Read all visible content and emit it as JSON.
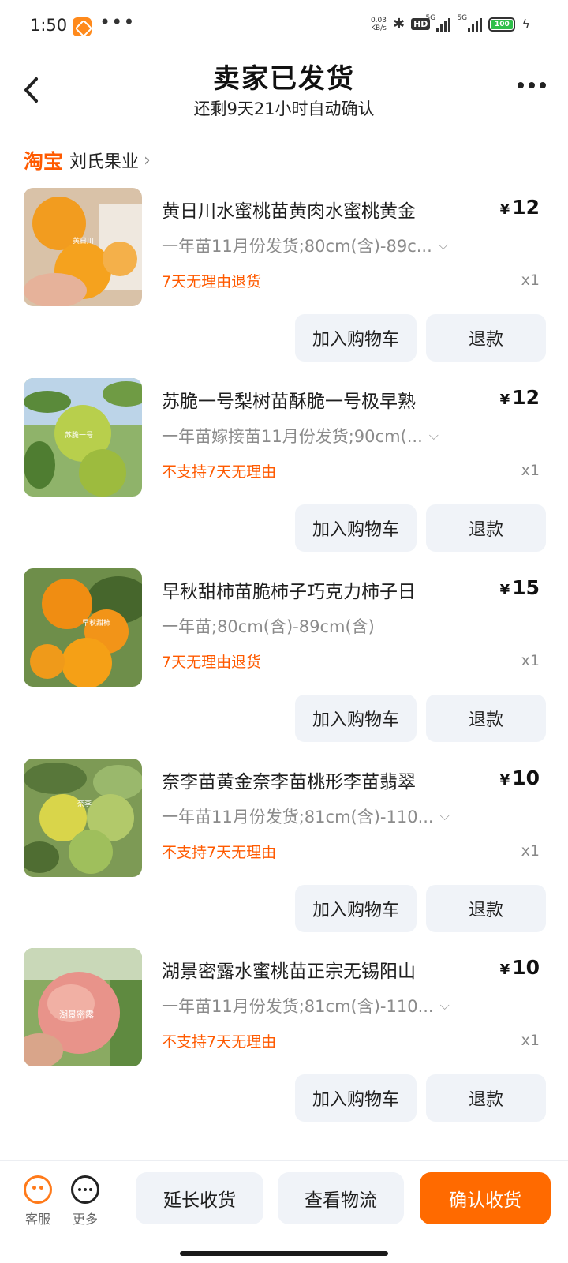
{
  "status_bar": {
    "time": "1:50",
    "net_speed_value": "0.03",
    "net_speed_unit": "KB/s",
    "hd_badge": "HD",
    "signal1_label": "5G",
    "signal2_label": "5G",
    "battery": "100"
  },
  "header": {
    "title": "卖家已发货",
    "subtitle": "还剩9天21小时自动确认"
  },
  "shop": {
    "platform": "淘宝",
    "name": "刘氏果业"
  },
  "items": [
    {
      "title": "黄日川水蜜桃苗黄肉水蜜桃黄金",
      "spec": "一年苗11月份发货;80cm(含)-89c...",
      "policy": "7天无理由退货",
      "price_symbol": "¥",
      "price": "12",
      "qty": "x1",
      "cart_label": "加入购物车",
      "refund_label": "退款",
      "thumb_caption": "黄日川"
    },
    {
      "title": "苏脆一号梨树苗酥脆一号极早熟",
      "spec": "一年苗嫁接苗11月份发货;90cm(...",
      "policy": "不支持7天无理由",
      "price_symbol": "¥",
      "price": "12",
      "qty": "x1",
      "cart_label": "加入购物车",
      "refund_label": "退款",
      "thumb_caption": "苏脆一号"
    },
    {
      "title": "早秋甜柿苗脆柿子巧克力柿子日",
      "spec": "一年苗;80cm(含)-89cm(含)",
      "policy": "7天无理由退货",
      "price_symbol": "¥",
      "price": "15",
      "qty": "x1",
      "cart_label": "加入购物车",
      "refund_label": "退款",
      "thumb_caption": "早秋甜柿"
    },
    {
      "title": "奈李苗黄金奈李苗桃形李苗翡翠",
      "spec": "一年苗11月份发货;81cm(含)-110...",
      "policy": "不支持7天无理由",
      "price_symbol": "¥",
      "price": "10",
      "qty": "x1",
      "cart_label": "加入购物车",
      "refund_label": "退款",
      "thumb_caption": "奈李"
    },
    {
      "title": "湖景密露水蜜桃苗正宗无锡阳山",
      "spec": "一年苗11月份发货;81cm(含)-110...",
      "policy": "不支持7天无理由",
      "price_symbol": "¥",
      "price": "10",
      "qty": "x1",
      "cart_label": "加入购物车",
      "refund_label": "退款",
      "thumb_caption": "湖景密露"
    }
  ],
  "bottom_bar": {
    "service_label": "客服",
    "more_label": "更多",
    "extend_label": "延长收货",
    "logistics_label": "查看物流",
    "confirm_label": "确认收货"
  },
  "colors": {
    "accent": "#ff6a00",
    "policy": "#ff5a00",
    "button_bg": "#f0f3f8"
  },
  "icons": [
    "back-arrow-icon",
    "more-dots-icon",
    "chevron-right-icon",
    "chevron-down-icon",
    "customer-service-icon",
    "more-circle-icon"
  ]
}
